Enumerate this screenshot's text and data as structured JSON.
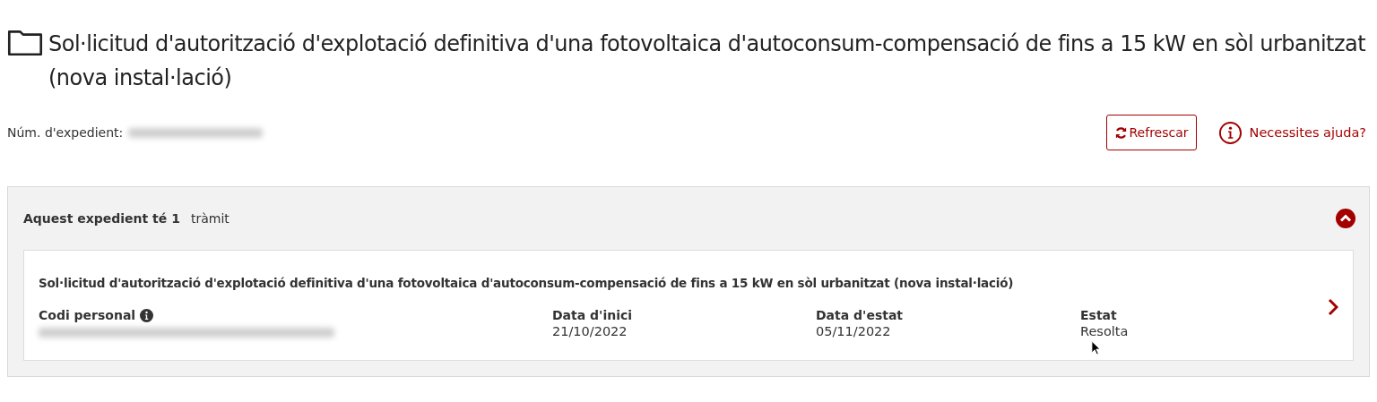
{
  "page_title": "Sol·licitud d'autorització d'explotació definitiva d'una fotovoltaica d'autoconsum-compensació de fins a 15 kW en sòl urbanitzat (nova instal·lació)",
  "file_number": {
    "label": "Núm. d'expedient:"
  },
  "actions": {
    "refresh": "Refrescar",
    "help": "Necessites ajuda?"
  },
  "panel": {
    "heading": "Aquest expedient té 1",
    "suffix": "tràmit",
    "expanded": true,
    "procedures": [
      {
        "title": "Sol·licitud d'autorització d'explotació definitiva d'una fotovoltaica d'autoconsum-compensació de fins a 15 kW en sòl urbanitzat (nova instal·lació)",
        "fields": [
          {
            "kind": "redacted",
            "label": "Codi personal",
            "info": true
          },
          {
            "kind": "text",
            "label": "Data d'inici",
            "value": "21/10/2022"
          },
          {
            "kind": "text",
            "label": "Data d'estat",
            "value": "05/11/2022"
          },
          {
            "kind": "text",
            "label": "Estat",
            "value": "Resolta"
          }
        ]
      }
    ]
  }
}
